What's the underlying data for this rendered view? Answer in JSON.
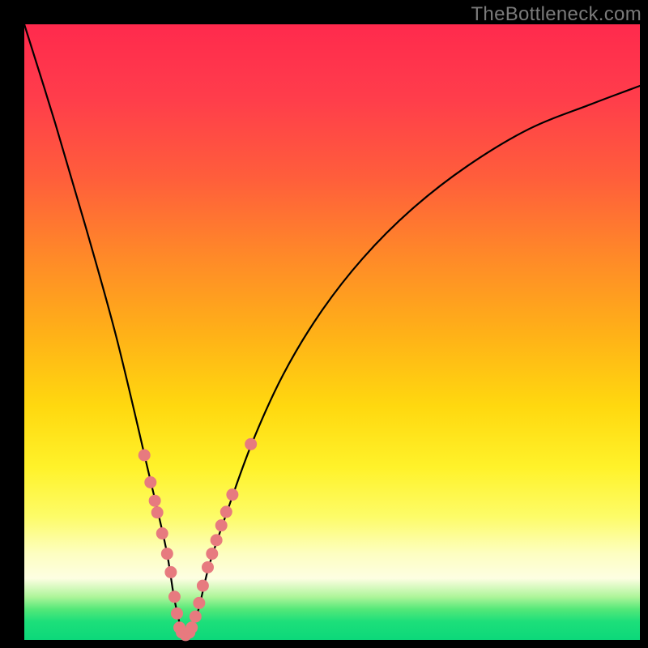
{
  "watermark": "TheBottleneck.com",
  "chart_data": {
    "type": "line",
    "title": "",
    "xlabel": "",
    "ylabel": "",
    "xlim": [
      0,
      1
    ],
    "ylim": [
      0,
      1
    ],
    "series": [
      {
        "name": "bottleneck-curve",
        "x": [
          0.0,
          0.05,
          0.1,
          0.15,
          0.2,
          0.23,
          0.245,
          0.26,
          0.28,
          0.3,
          0.33,
          0.37,
          0.42,
          0.48,
          0.55,
          0.63,
          0.72,
          0.82,
          0.92,
          1.0
        ],
        "y": [
          1.0,
          0.84,
          0.67,
          0.49,
          0.28,
          0.15,
          0.06,
          0.01,
          0.04,
          0.12,
          0.21,
          0.32,
          0.43,
          0.53,
          0.62,
          0.7,
          0.77,
          0.83,
          0.87,
          0.9
        ]
      }
    ],
    "markers": {
      "name": "highlighted-points",
      "color": "#e77a7f",
      "radius": 7,
      "points": [
        {
          "x": 0.195,
          "y": 0.3
        },
        {
          "x": 0.205,
          "y": 0.256
        },
        {
          "x": 0.212,
          "y": 0.226
        },
        {
          "x": 0.216,
          "y": 0.207
        },
        {
          "x": 0.224,
          "y": 0.173
        },
        {
          "x": 0.232,
          "y": 0.14
        },
        {
          "x": 0.238,
          "y": 0.11
        },
        {
          "x": 0.244,
          "y": 0.07
        },
        {
          "x": 0.248,
          "y": 0.043
        },
        {
          "x": 0.252,
          "y": 0.02
        },
        {
          "x": 0.256,
          "y": 0.012
        },
        {
          "x": 0.262,
          "y": 0.008
        },
        {
          "x": 0.268,
          "y": 0.012
        },
        {
          "x": 0.272,
          "y": 0.02
        },
        {
          "x": 0.278,
          "y": 0.038
        },
        {
          "x": 0.284,
          "y": 0.06
        },
        {
          "x": 0.29,
          "y": 0.088
        },
        {
          "x": 0.298,
          "y": 0.118
        },
        {
          "x": 0.305,
          "y": 0.14
        },
        {
          "x": 0.312,
          "y": 0.162
        },
        {
          "x": 0.32,
          "y": 0.186
        },
        {
          "x": 0.328,
          "y": 0.208
        },
        {
          "x": 0.338,
          "y": 0.236
        },
        {
          "x": 0.368,
          "y": 0.318
        }
      ]
    }
  }
}
